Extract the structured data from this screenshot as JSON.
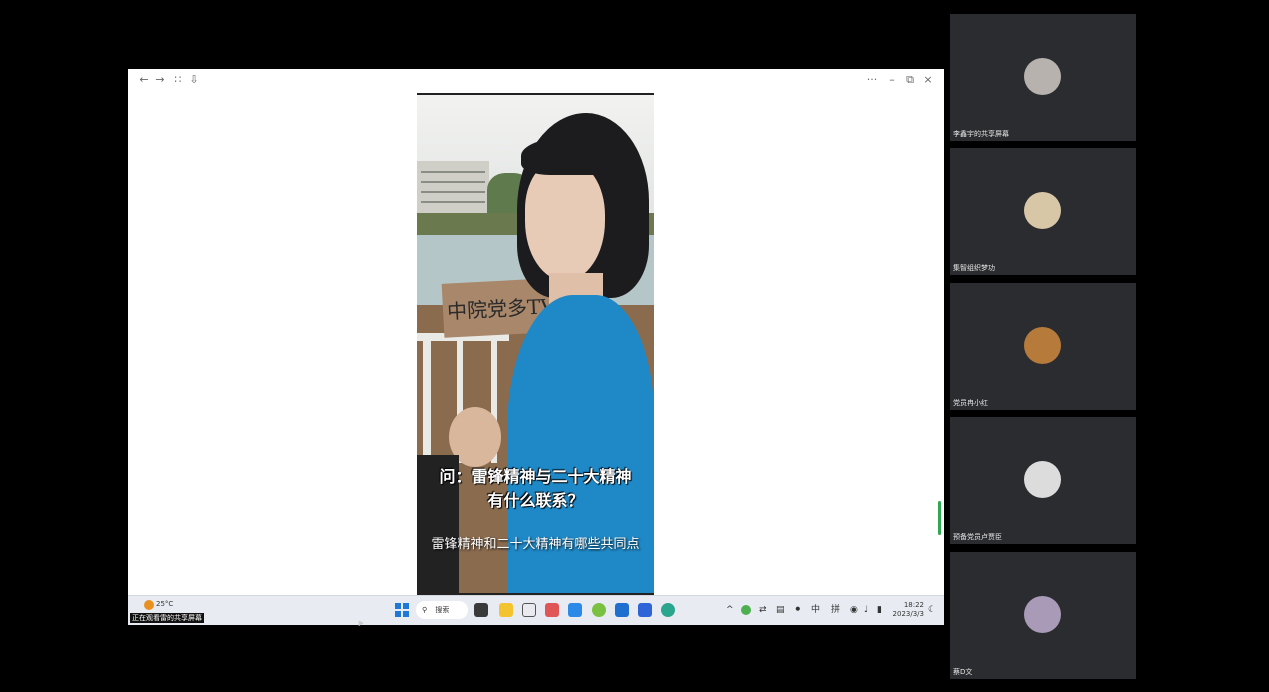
{
  "toolbar": {
    "back_icon": "arrow-left-icon",
    "forward_icon": "arrow-right-icon",
    "grid_icon": "grid-icon",
    "save_icon": "save-icon",
    "more_label": "···",
    "minimize_label": "–",
    "restore_label": "⧉",
    "close_label": "×"
  },
  "video": {
    "sign_text": "中院党多TV",
    "question_line1": "问：雷锋精神与二十大精神",
    "question_line2": "有什么联系？",
    "subtitle": "雷锋精神和二十大精神有哪些共同点"
  },
  "taskbar": {
    "weather_temp": "25°C",
    "share_label": "正在观看雷的共享屏幕",
    "search_label": "搜索",
    "apps": [
      "task-view-icon",
      "file-explorer-icon",
      "chart-app-icon",
      "red-app-icon",
      "cloud-app-icon",
      "green-app-icon",
      "blue-app-icon",
      "video-app-icon",
      "edge-icon"
    ],
    "tray_chevron": "^",
    "tray_ime_lang": "中",
    "tray_ime_mode": "拼",
    "time": "18:22",
    "date": "2023/3/3"
  },
  "participants": [
    {
      "name": "李鑫宇的共享屏幕",
      "avatar": "girl-portrait-avatar",
      "color": "#b8b2ae"
    },
    {
      "name": "集智组织梦功",
      "avatar": "child-portrait-avatar",
      "color": "#d8c7a6"
    },
    {
      "name": "党员冉小红",
      "avatar": "food-photo-avatar",
      "color": "#b67a3a"
    },
    {
      "name": "预备党员卢贾臣",
      "avatar": "dark-hair-avatar",
      "color": "#dcdcdc"
    },
    {
      "name": "蔡D文",
      "avatar": "harbor-photo-avatar",
      "color": "#a99ab8"
    }
  ]
}
